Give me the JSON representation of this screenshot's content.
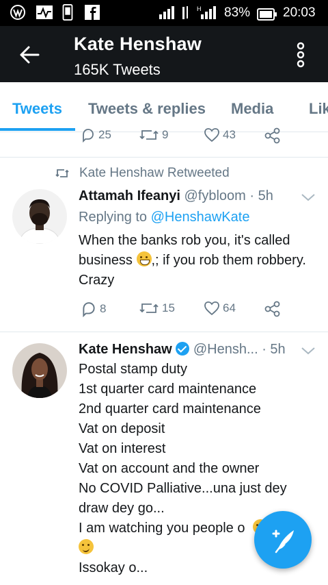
{
  "status_bar": {
    "battery": "83%",
    "time": "20:03",
    "icons": [
      "wordpress-icon",
      "activity-icon",
      "phone-icon",
      "facebook-icon",
      "signal-icon",
      "data-icon",
      "signal-h-icon",
      "battery-icon"
    ]
  },
  "app_bar": {
    "title": "Kate Henshaw",
    "subtitle": "165K Tweets"
  },
  "tabs": [
    "Tweets",
    "Tweets & replies",
    "Media",
    "Lik"
  ],
  "prev_tweet_actions": {
    "replies": "25",
    "retweets": "9",
    "likes": "43"
  },
  "tweet1": {
    "retweet_label": "Kate Henshaw Retweeted",
    "name": "Attamah Ifeanyi",
    "handle": "@fybloom",
    "time": "· 5h",
    "reply_prefix": "Replying to ",
    "reply_handle": "@HenshawKate",
    "text_part1": "When the banks rob you, it's called business ",
    "text_part2": ",; if you rob them robbery. Crazy",
    "replies": "8",
    "retweets": "15",
    "likes": "64"
  },
  "tweet2": {
    "name": "Kate Henshaw",
    "handle": "@Hensh...",
    "time": "· 5h",
    "lines": [
      "Postal stamp duty",
      "1st quarter card maintenance",
      "2nd quarter card maintenance",
      "Vat on deposit",
      "Vat on interest",
      "Vat on account and the owner",
      "No COVID Palliative...una just dey draw dey go...",
      "I am watching you people o",
      "Issokay o..."
    ]
  },
  "colors": {
    "accent": "#1da1f2",
    "header_bg": "#14171a",
    "muted": "#657786"
  }
}
